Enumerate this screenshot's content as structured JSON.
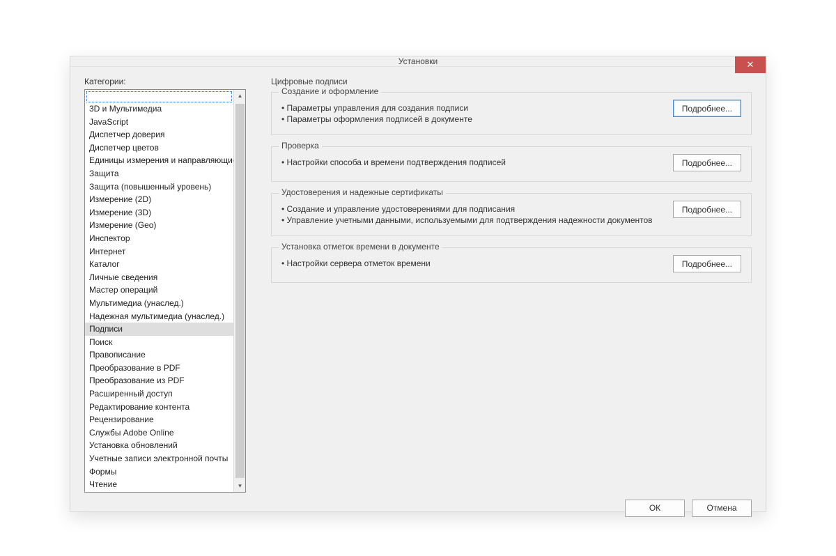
{
  "dialog": {
    "title": "Установки",
    "close_glyph": "✕"
  },
  "sidebar": {
    "label": "Категории:",
    "items": [
      "",
      "3D и Мультимедиа",
      "JavaScript",
      "Диспетчер доверия",
      "Диспетчер цветов",
      "Единицы измерения и направляющие",
      "Защита",
      "Защита (повышенный уровень)",
      "Измерение (2D)",
      "Измерение (3D)",
      "Измерение (Geo)",
      "Инспектор",
      "Интернет",
      "Каталог",
      "Личные сведения",
      "Мастер операций",
      "Мультимедиа (унаслед.)",
      "Надежная мультимедиа (унаслед.)",
      "Подписи",
      "Поиск",
      "Правописание",
      "Преобразование в PDF",
      "Преобразование из PDF",
      "Расширенный доступ",
      "Редактирование контента",
      "Рецензирование",
      "Службы Adobe Online",
      "Установка обновлений",
      "Учетные записи электронной почты",
      "Формы",
      "Чтение"
    ],
    "selected_index": 18
  },
  "main": {
    "heading": "Цифровые подписи",
    "groups": [
      {
        "legend": "Создание и оформление",
        "bullets": [
          "Параметры управления для создания подписи",
          "Параметры оформления подписей в документе"
        ],
        "button": "Подробнее...",
        "highlight": true
      },
      {
        "legend": "Проверка",
        "bullets": [
          "Настройки способа и времени подтверждения подписей"
        ],
        "button": "Подробнее...",
        "highlight": false
      },
      {
        "legend": "Удостоверения и надежные сертификаты",
        "bullets": [
          "Создание и управление удостоверениями для подписания",
          "Управление учетными данными, используемыми для подтверждения надежности документов"
        ],
        "button": "Подробнее...",
        "highlight": false
      },
      {
        "legend": "Установка отметок времени в документе",
        "bullets": [
          "Настройки сервера отметок времени"
        ],
        "button": "Подробнее...",
        "highlight": false
      }
    ]
  },
  "footer": {
    "ok": "ОК",
    "cancel": "Отмена"
  }
}
